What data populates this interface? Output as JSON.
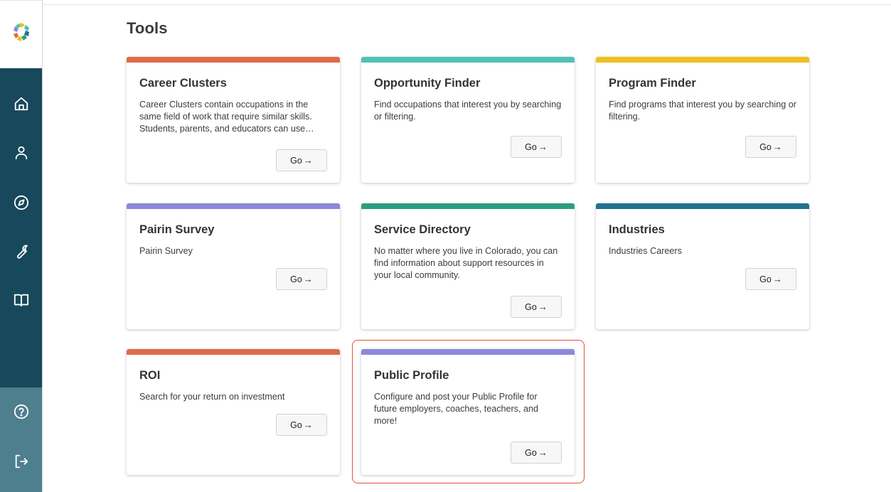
{
  "page": {
    "title": "Tools"
  },
  "sidebar": {
    "nav": [
      {
        "name": "home-icon"
      },
      {
        "name": "user-icon"
      },
      {
        "name": "compass-icon"
      },
      {
        "name": "wrench-icon"
      },
      {
        "name": "book-icon"
      }
    ],
    "footer": [
      {
        "name": "help-icon"
      },
      {
        "name": "logout-icon"
      }
    ]
  },
  "colors": {
    "sidebar": "#17485c",
    "sidebar_footer": "#4e7f8f",
    "orange": "#e06a47",
    "teal": "#4dc2b5",
    "yellow": "#f0c020",
    "purple": "#8c88dc",
    "green": "#2f9c82",
    "blue": "#22738f",
    "highlight": "#e0533a"
  },
  "cards": [
    {
      "title": "Career Clusters",
      "description": "Career Clusters contain occupations in the same field of work that require similar skills. Students, parents, and educators can use…",
      "button": "Go",
      "color": "#e06a47"
    },
    {
      "title": "Opportunity Finder",
      "description": "Find occupations that interest you by searching or filtering.",
      "button": "Go",
      "color": "#4dc2b5"
    },
    {
      "title": "Program Finder",
      "description": "Find programs that interest you by searching or filtering.",
      "button": "Go",
      "color": "#f0c020"
    },
    {
      "title": "Pairin Survey",
      "description": "Pairin Survey",
      "button": "Go",
      "color": "#8c88dc"
    },
    {
      "title": "Service Directory",
      "description": "No matter where you live in Colorado, you can find information about support resources in your local community.",
      "button": "Go",
      "color": "#2f9c82"
    },
    {
      "title": "Industries",
      "description": "Industries Careers",
      "button": "Go",
      "color": "#22738f"
    },
    {
      "title": "ROI",
      "description": "Search for your return on investment",
      "button": "Go",
      "color": "#e06a47"
    },
    {
      "title": "Public Profile",
      "description": "Configure and post your Public Profile for future employers, coaches, teachers, and more!",
      "button": "Go",
      "color": "#8c88dc"
    }
  ]
}
